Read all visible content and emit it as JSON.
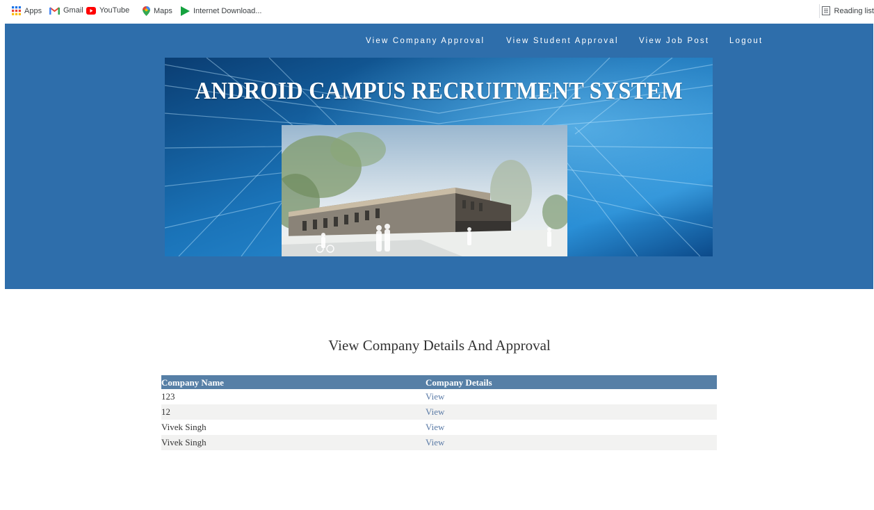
{
  "bookmarks": [
    {
      "label": "Apps",
      "icon": "apps-grid-icon"
    },
    {
      "label": "Gmail",
      "icon": "gmail-icon"
    },
    {
      "label": "YouTube",
      "icon": "youtube-icon"
    },
    {
      "label": "Maps",
      "icon": "maps-pin-icon"
    },
    {
      "label": "Internet Download...",
      "icon": "download-play-icon"
    }
  ],
  "reading_list": {
    "label": "Reading list",
    "icon": "reading-list-icon"
  },
  "nav": {
    "company_approval": "View Company Approval",
    "student_approval": "View Student Approval",
    "job_post": "View Job Post",
    "logout": "Logout"
  },
  "banner": {
    "title": "ANDROID CAMPUS RECRUITMENT SYSTEM"
  },
  "main": {
    "heading": "View Company Details And Approval",
    "table": {
      "headers": [
        "Company Name",
        "Company Details"
      ],
      "rows": [
        {
          "name": "123",
          "action": "View"
        },
        {
          "name": "12",
          "action": "View"
        },
        {
          "name": "Vivek Singh",
          "action": "View"
        },
        {
          "name": "Vivek Singh",
          "action": "View"
        }
      ]
    }
  },
  "colors": {
    "header_bg": "#2e6eab",
    "table_header_bg": "#567fa6",
    "link": "#5a7aa6"
  }
}
